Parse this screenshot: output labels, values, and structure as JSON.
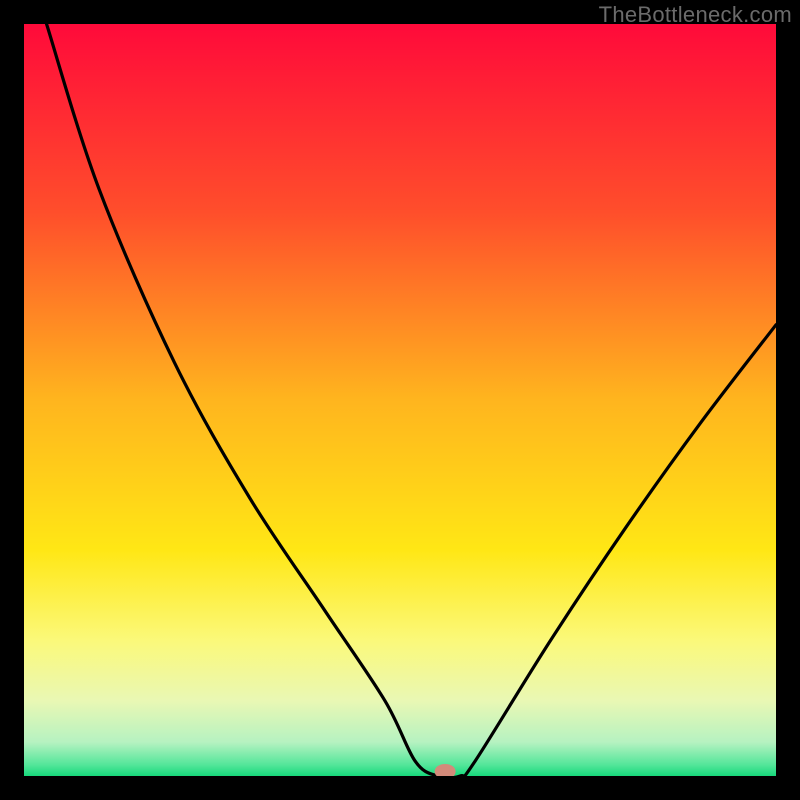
{
  "watermark": "TheBottleneck.com",
  "chart_data": {
    "type": "line",
    "title": "",
    "xlabel": "",
    "ylabel": "",
    "xlim": [
      0,
      100
    ],
    "ylim": [
      0,
      100
    ],
    "grid": false,
    "legend": false,
    "series": [
      {
        "name": "curve",
        "x": [
          3,
          10,
          20,
          30,
          40,
          48,
          52,
          55,
          58,
          60,
          70,
          80,
          90,
          100
        ],
        "y": [
          100,
          78,
          55,
          37,
          22,
          10,
          2,
          0,
          0,
          2,
          18,
          33,
          47,
          60
        ]
      }
    ],
    "marker": {
      "x": 56,
      "y": 0.6,
      "rx": 1.4,
      "ry": 1.0,
      "color": "#d38a7a"
    },
    "background_gradient": {
      "stops": [
        {
          "offset": 0.0,
          "color": "#ff0a3a"
        },
        {
          "offset": 0.25,
          "color": "#ff4e2b"
        },
        {
          "offset": 0.5,
          "color": "#ffb51e"
        },
        {
          "offset": 0.7,
          "color": "#ffe715"
        },
        {
          "offset": 0.82,
          "color": "#fbf97a"
        },
        {
          "offset": 0.9,
          "color": "#e9f8b4"
        },
        {
          "offset": 0.955,
          "color": "#b6f2c1"
        },
        {
          "offset": 0.985,
          "color": "#54e69a"
        },
        {
          "offset": 1.0,
          "color": "#17d87b"
        }
      ]
    }
  }
}
